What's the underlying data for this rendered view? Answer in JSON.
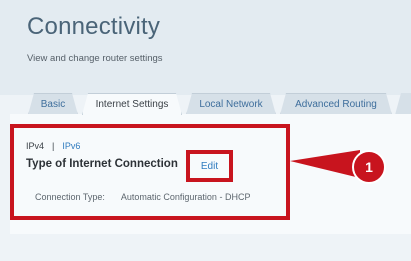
{
  "header": {
    "title": "Connectivity",
    "subtitle": "View and change router settings"
  },
  "tabs": [
    {
      "label": "Basic",
      "active": false
    },
    {
      "label": "Internet Settings",
      "active": true
    },
    {
      "label": "Local Network",
      "active": false
    },
    {
      "label": "Advanced Routing",
      "active": false
    }
  ],
  "section": {
    "ipv4_label": "IPv4",
    "separator": "|",
    "ipv6_label": "IPv6",
    "title": "Type of Internet Connection",
    "edit_label": "Edit",
    "connection_type_label": "Connection Type:",
    "connection_type_value": "Automatic Configuration - DHCP"
  },
  "annotation": {
    "callout_number": "1",
    "color": "#c8141e"
  }
}
